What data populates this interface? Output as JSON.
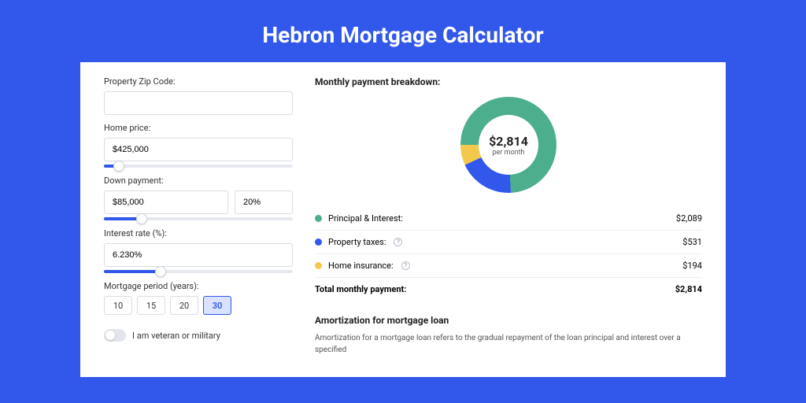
{
  "title": "Hebron Mortgage Calculator",
  "form": {
    "zip_label": "Property Zip Code:",
    "zip_value": "",
    "home_price_label": "Home price:",
    "home_price_value": "$425,000",
    "home_price_slider_pct": 8,
    "down_payment_label": "Down payment:",
    "down_payment_value": "$85,000",
    "down_payment_pct_value": "20%",
    "down_payment_slider_pct": 20,
    "interest_rate_label": "Interest rate (%):",
    "interest_rate_value": "6.230%",
    "interest_rate_slider_pct": 30,
    "mortgage_period_label": "Mortgage period (years):",
    "periods": [
      "10",
      "15",
      "20",
      "30"
    ],
    "period_active": "30",
    "veteran_label": "I am veteran or military"
  },
  "breakdown": {
    "title": "Monthly payment breakdown:",
    "donut_amount": "$2,814",
    "donut_sub": "per month",
    "rows": [
      {
        "label": "Principal & Interest:",
        "value": "$2,089",
        "color": "#4cae8c",
        "info": false
      },
      {
        "label": "Property taxes:",
        "value": "$531",
        "color": "#3157eb",
        "info": true
      },
      {
        "label": "Home insurance:",
        "value": "$194",
        "color": "#f2c94c",
        "info": true
      }
    ],
    "total_label": "Total monthly payment:",
    "total_value": "$2,814"
  },
  "amort": {
    "title": "Amortization for mortgage loan",
    "text": "Amortization for a mortgage loan refers to the gradual repayment of the loan principal and interest over a specified"
  },
  "chart_data": {
    "type": "pie",
    "title": "Monthly payment breakdown",
    "series": [
      {
        "name": "Principal & Interest",
        "value": 2089,
        "color": "#4cae8c"
      },
      {
        "name": "Property taxes",
        "value": 531,
        "color": "#3157eb"
      },
      {
        "name": "Home insurance",
        "value": 194,
        "color": "#f2c94c"
      }
    ],
    "center_label": "$2,814 per month"
  }
}
